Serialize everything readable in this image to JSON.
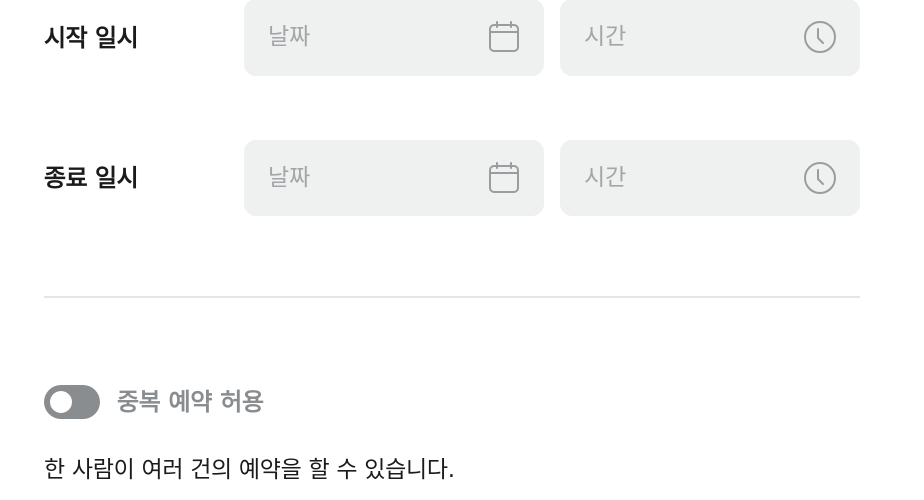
{
  "start": {
    "label": "시작 일시",
    "date_placeholder": "날짜",
    "time_placeholder": "시간"
  },
  "end": {
    "label": "종료 일시",
    "date_placeholder": "날짜",
    "time_placeholder": "시간"
  },
  "duplicate_booking": {
    "label": "중복 예약 허용",
    "enabled": false,
    "description": "한 사람이 여러 건의 예약을 할 수 있습니다."
  },
  "icons": {
    "date": "calendar-icon",
    "time": "clock-icon"
  },
  "colors": {
    "field_background": "#eff0f0",
    "placeholder": "#a3a6a8",
    "icon": "#9a9da0",
    "toggle_off": "#8a8d90",
    "text": "#1b1b1b",
    "divider": "#e4e5e6"
  }
}
